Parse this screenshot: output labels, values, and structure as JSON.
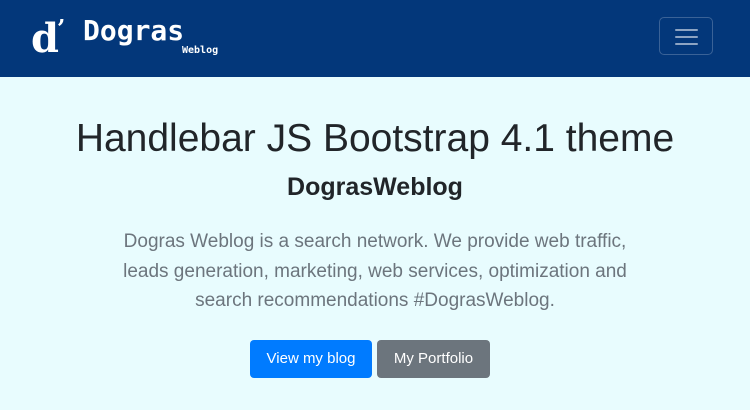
{
  "navbar": {
    "brand": {
      "mark": "d",
      "apostrophe": "’",
      "name": "Dogras",
      "sub": "Weblog"
    },
    "toggler_icon": "hamburger-menu-icon",
    "background": "#03377a"
  },
  "jumbotron": {
    "title": "Handlebar JS Bootstrap 4.1 theme",
    "subtitle": "DograsWeblog",
    "lead": "Dogras Weblog is a search network. We provide web traffic, leads generation, marketing, web services, optimization and search recommendations #DograsWeblog.",
    "background": "#e8fcfe"
  },
  "buttons": {
    "primary_label": "View my blog",
    "secondary_label": "My Portfolio",
    "primary_color": "#007bff",
    "secondary_color": "#6c757d"
  }
}
